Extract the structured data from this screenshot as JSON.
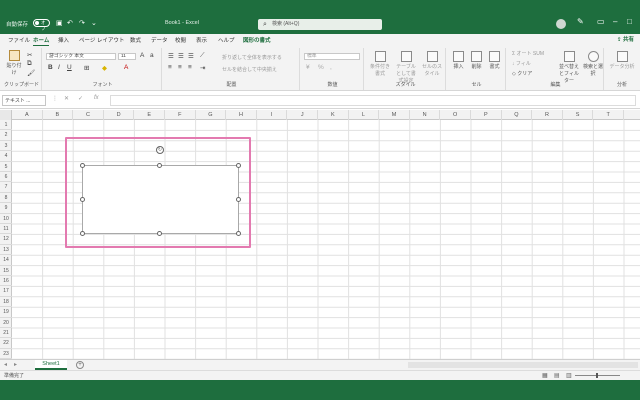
{
  "title_bar": {
    "autosave_label": "自動保存",
    "autosave_state": "オフ",
    "doc_title": "Book1 - Excel",
    "search_placeholder": "検索 (Alt+Q)",
    "undo_icon": "undo-icon",
    "redo_icon": "redo-icon"
  },
  "tabs": [
    "ファイル",
    "ホーム",
    "挿入",
    "ページ レイアウト",
    "数式",
    "データ",
    "校閲",
    "表示",
    "ヘルプ",
    "図形の書式"
  ],
  "active_tab": "ホーム",
  "share_label": "共有",
  "ribbon": {
    "groups": [
      {
        "label": "クリップボード",
        "buttons": [
          "貼り付け"
        ]
      },
      {
        "label": "フォント",
        "font_name": "游ゴシック 本文",
        "font_size": "11",
        "format_buttons": [
          "B",
          "I",
          "U"
        ]
      },
      {
        "label": "配置",
        "buttons": [
          "折り返して全体を表示する",
          "セルを結合して中央揃え"
        ]
      },
      {
        "label": "数値",
        "format": "標準"
      },
      {
        "label": "スタイル",
        "buttons": [
          "条件付き書式",
          "テーブルとして書式設定",
          "セルのスタイル"
        ]
      },
      {
        "label": "セル",
        "buttons": [
          "挿入",
          "削除",
          "書式"
        ]
      },
      {
        "label": "編集",
        "buttons": [
          "オート SUM",
          "フィル",
          "クリア",
          "並べ替えとフィルター",
          "検索と選択"
        ]
      },
      {
        "label": "分析",
        "buttons": [
          "データ分析"
        ]
      }
    ]
  },
  "formula_bar": {
    "name_box": "テキスト ...",
    "fx_label": "fx",
    "value": ""
  },
  "columns": [
    "A",
    "B",
    "C",
    "D",
    "E",
    "F",
    "G",
    "H",
    "I",
    "J",
    "K",
    "L",
    "M",
    "N",
    "O",
    "P",
    "Q",
    "R",
    "S",
    "T"
  ],
  "rows": [
    "1",
    "2",
    "3",
    "4",
    "5",
    "6",
    "7",
    "8",
    "9",
    "10",
    "11",
    "12",
    "13",
    "14",
    "15",
    "16",
    "17",
    "18",
    "19",
    "20",
    "21",
    "22",
    "23"
  ],
  "sheets": [
    "Sheet1"
  ],
  "status": {
    "ready": "準備完了"
  },
  "colors": {
    "brand": "#1e6e3e",
    "highlight": "#e37ab0"
  }
}
